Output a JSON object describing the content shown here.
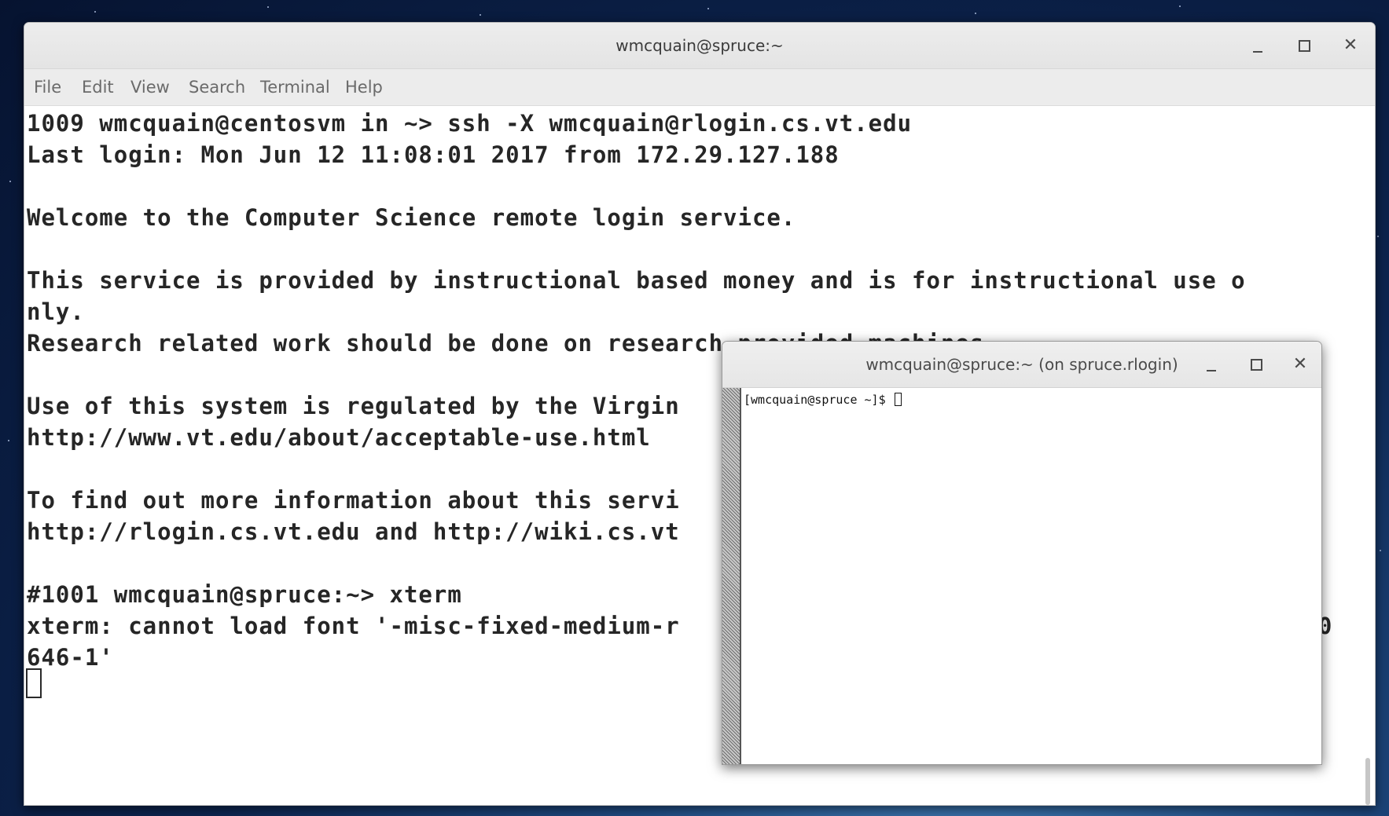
{
  "main_window": {
    "title": "wmcquain@spruce:~",
    "menu": [
      "File",
      "Edit",
      "View",
      "Search",
      "Terminal",
      "Help"
    ],
    "lines": [
      "1009 wmcquain@centosvm in ~> ssh -X wmcquain@rlogin.cs.vt.edu",
      "Last login: Mon Jun 12 11:08:01 2017 from 172.29.127.188",
      "",
      "Welcome to the Computer Science remote login service.",
      "",
      "This service is provided by instructional based money and is for instructional use o",
      "nly.",
      "Research related work should be done on research provided machines.",
      "",
      "Use of this system is regulated by the Virgin",
      "http://www.vt.edu/about/acceptable-use.html",
      "",
      "To find out more information about this servi",
      "http://rlogin.cs.vt.edu and http://wiki.cs.vt",
      "",
      "#1001 wmcquain@spruce:~> xterm",
      "xterm: cannot load font '-misc-fixed-medium-r                                            0",
      "646-1'"
    ]
  },
  "xterm_window": {
    "title": "wmcquain@spruce:~ (on spruce.rlogin)",
    "prompt": "[wmcquain@spruce ~]$ "
  }
}
